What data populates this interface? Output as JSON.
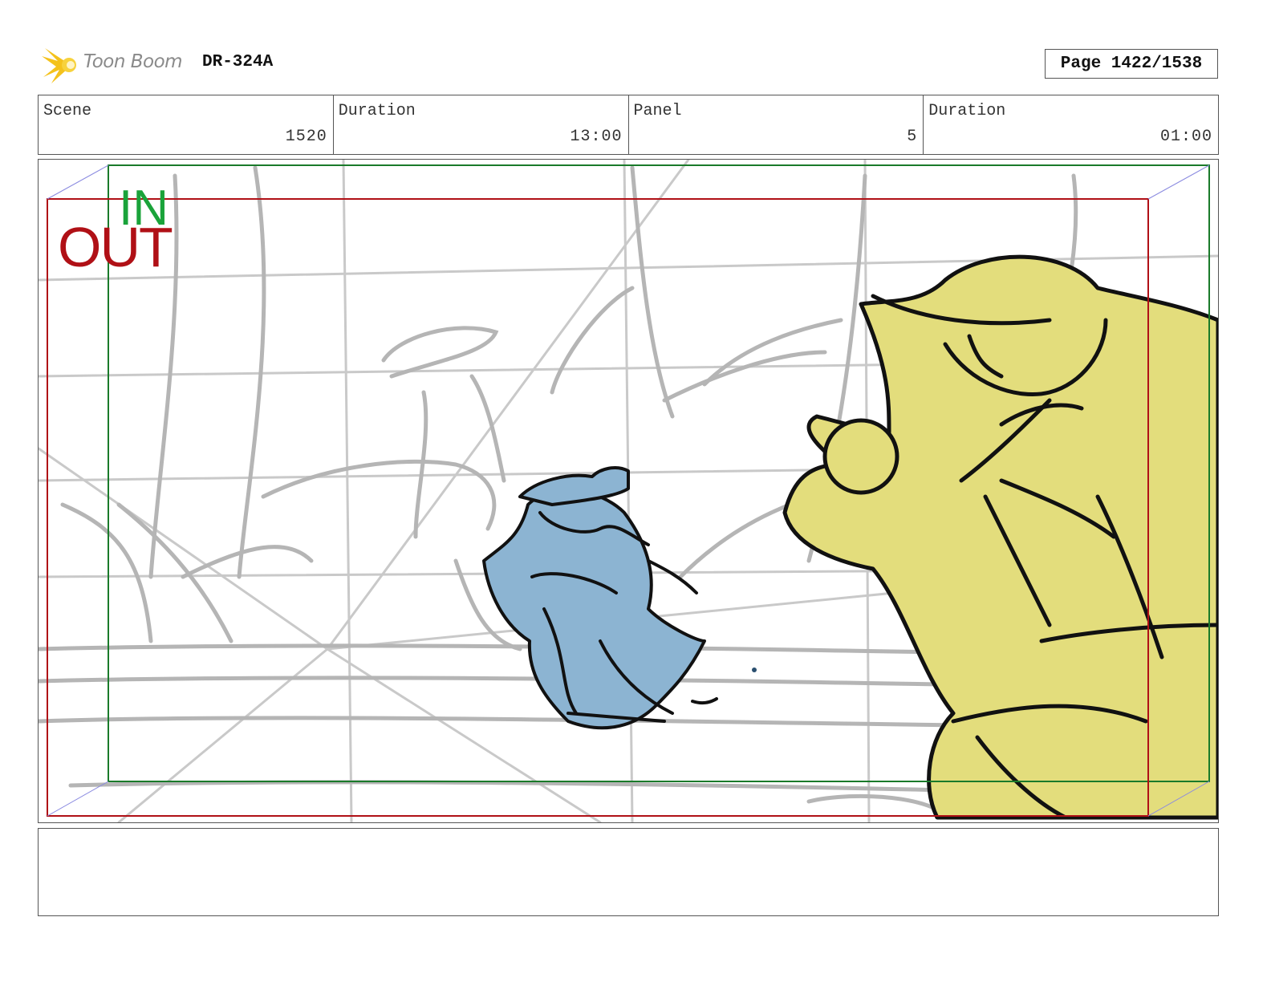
{
  "header": {
    "logo_text": "Toon Boom",
    "production_code": "DR-324A",
    "page_label": "Page 1422/1538"
  },
  "info": {
    "scene": {
      "label": "Scene",
      "value": "1520"
    },
    "scene_duration": {
      "label": "Duration",
      "value": "13:00"
    },
    "panel": {
      "label": "Panel",
      "value": "5"
    },
    "panel_duration": {
      "label": "Duration",
      "value": "01:00"
    }
  },
  "frame_markers": {
    "in_label": "IN",
    "out_label": "OUT",
    "in_color": "#1aa33a",
    "out_color": "#b01016"
  },
  "drawing_colors": {
    "character_blue": "#8cb4d2",
    "character_yellow": "#e3dd7c",
    "sketch_gray": "#b9b9b9"
  },
  "notes": {
    "text": ""
  }
}
